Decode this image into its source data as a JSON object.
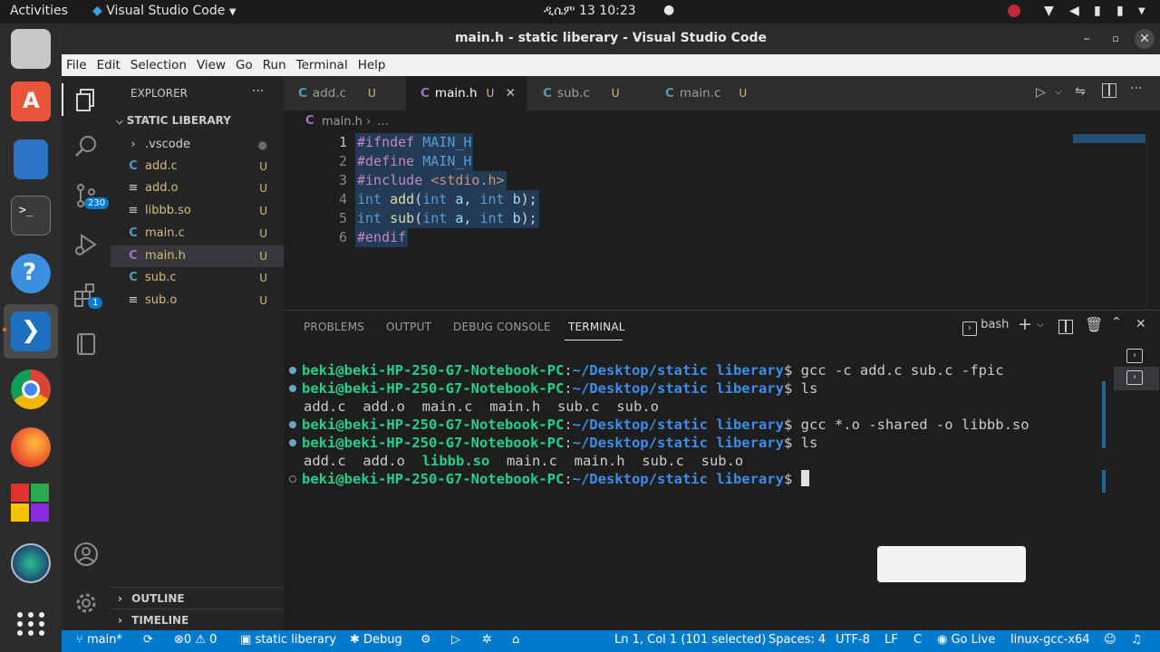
{
  "topbar": {
    "activities": "Activities",
    "app_name": "Visual Studio Code",
    "clock": "ዲሴም 13  10:23"
  },
  "window": {
    "title": "main.h - static liberary - Visual Studio Code"
  },
  "menu": [
    "File",
    "Edit",
    "Selection",
    "View",
    "Go",
    "Run",
    "Terminal",
    "Help"
  ],
  "activity": {
    "scm_badge": "230",
    "extensions_badge": "1"
  },
  "sidebar": {
    "header": "EXPLORER",
    "more": "···",
    "folder": "STATIC LIBERARY",
    "items": [
      {
        "icon": "›",
        "name": ".vscode",
        "status": "●"
      },
      {
        "icon": "C",
        "name": "add.c",
        "status": "U"
      },
      {
        "icon": "≡",
        "name": "add.o",
        "status": "U"
      },
      {
        "icon": "≡",
        "name": "libbb.so",
        "status": "U"
      },
      {
        "icon": "C",
        "name": "main.c",
        "status": "U"
      },
      {
        "icon": "C",
        "name": "main.h",
        "status": "U"
      },
      {
        "icon": "C",
        "name": "sub.c",
        "status": "U"
      },
      {
        "icon": "≡",
        "name": "sub.o",
        "status": "U"
      }
    ],
    "outline": "OUTLINE",
    "timeline": "TIMELINE"
  },
  "tabs": [
    {
      "label": "add.c",
      "status": "U"
    },
    {
      "label": "main.h",
      "status": "U"
    },
    {
      "label": "sub.c",
      "status": "U"
    },
    {
      "label": "main.c",
      "status": "U"
    }
  ],
  "breadcrumb": {
    "file": "main.h",
    "more": "…"
  },
  "editor": {
    "lines": [
      "1",
      "2",
      "3",
      "4",
      "5",
      "6"
    ]
  },
  "panel": {
    "tabs": [
      "PROBLEMS",
      "OUTPUT",
      "DEBUG CONSOLE",
      "TERMINAL"
    ],
    "shell": "bash"
  },
  "terminal": {
    "prompt_user": "beki@beki-HP-250-G7-Notebook-PC",
    "prompt_path": "~/Desktop/static liberary",
    "cmd1": " gcc -c add.c sub.c -fpic",
    "cmd2": " ls",
    "out1": "add.c  add.o  main.c  main.h  sub.c  sub.o",
    "cmd3": " gcc *.o -shared -o libbb.so",
    "cmd4": " ls",
    "out2a": "add.c  add.o  ",
    "out2b": "libbb.so",
    "out2c": "  main.c  main.h  sub.c  sub.o"
  },
  "status": {
    "branch": "main*",
    "errors": "0",
    "warnings": "0",
    "folder": "static liberary",
    "debug": "Debug",
    "position": "Ln 1, Col 1 (101 selected)",
    "spaces": "Spaces: 4",
    "encoding": "UTF-8",
    "eol": "LF",
    "lang": "C",
    "golive": "Go Live",
    "config": "linux-gcc-x64"
  },
  "colors": {
    "accent": "#007acc",
    "keyword": "#569cd6",
    "preproc": "#c586c0",
    "prompt": "#23d18b",
    "path": "#3b8eea"
  }
}
